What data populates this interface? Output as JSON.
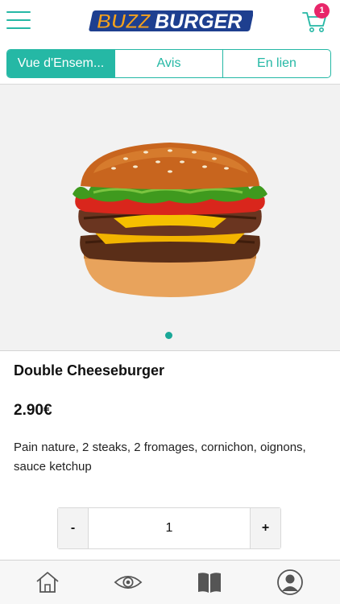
{
  "header": {
    "logo_text": "BUZZBURGER",
    "cart_count": "1"
  },
  "tabs": [
    {
      "label": "Vue d'Ensem...",
      "active": true
    },
    {
      "label": "Avis",
      "active": false
    },
    {
      "label": "En lien",
      "active": false
    }
  ],
  "product": {
    "name": "Double Cheeseburger",
    "price": "2.90€",
    "description": "Pain nature, 2 steaks, 2 fromages, cornichon, oignons, sauce ketchup"
  },
  "gallery": {
    "image_count": 1,
    "active_index": 0
  },
  "quantity": {
    "minus_label": "-",
    "value": "1",
    "plus_label": "+"
  },
  "bottom_nav": [
    {
      "icon": "home-icon"
    },
    {
      "icon": "eye-icon"
    },
    {
      "icon": "book-icon"
    },
    {
      "icon": "user-icon"
    }
  ],
  "colors": {
    "accent": "#25b8a5",
    "badge": "#e8266a",
    "logo_orange": "#f7a21b",
    "logo_blue": "#1e3f8f"
  }
}
